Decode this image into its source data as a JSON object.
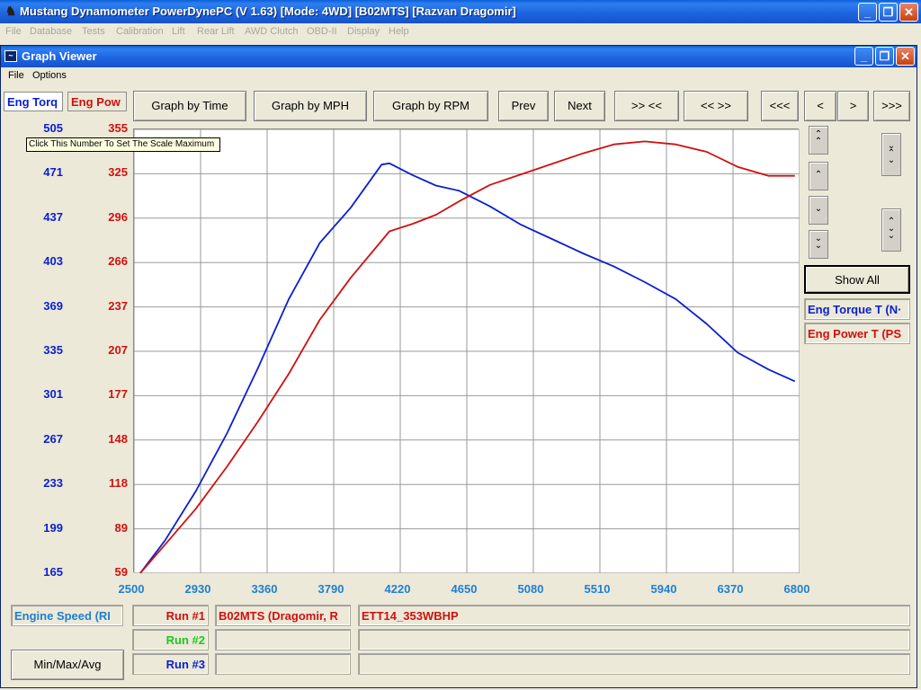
{
  "window": {
    "title": "Mustang Dynamometer PowerDynePC (V 1.63) [Mode: 4WD] [B02MTS] [Razvan Dragomir]",
    "minimize": "_",
    "restore": "❐",
    "close": "✕"
  },
  "menu": [
    "File",
    "Database",
    "Tests",
    "Calibration",
    "Lift",
    "Rear Lift",
    "AWD Clutch",
    "OBD-II",
    "Display",
    "Help"
  ],
  "graph_viewer": {
    "title": "Graph Viewer",
    "menu": [
      "File",
      "Options"
    ],
    "tabs": [
      "Eng Torq",
      "Eng Pow"
    ],
    "toolbar": {
      "graph_by_time": "Graph by Time",
      "graph_by_mph": "Graph by MPH",
      "graph_by_rpm": "Graph by RPM",
      "prev": "Prev",
      "next": "Next",
      "zoom_in": ">> <<",
      "zoom_out": "<< >>",
      "scroll_far_left": "<<<",
      "scroll_left": "<",
      "scroll_right": ">",
      "scroll_far_right": ">>>"
    },
    "tooltip": "Click This Number To Set The Scale Maximum",
    "show_all": "Show All",
    "legend": [
      {
        "label": "Eng Torque T (N·",
        "color": "#0a1fd0"
      },
      {
        "label": "Eng Power T (PS",
        "color": "#d01010"
      }
    ],
    "x_axis_name": "Engine Speed (RI",
    "min_max_avg": "Min/Max/Avg",
    "runs": [
      {
        "label": "Run #1",
        "color": "#d01010",
        "name": "B02MTS (Dragomir, R",
        "desc": "ETT14_353WBHP"
      },
      {
        "label": "Run #2",
        "color": "#1ec81e",
        "name": "",
        "desc": ""
      },
      {
        "label": "Run #3",
        "color": "#0a1fd0",
        "name": "",
        "desc": ""
      }
    ]
  },
  "chart_data": {
    "type": "line",
    "x_ticks": [
      2500,
      2930,
      3360,
      3790,
      4220,
      4650,
      5080,
      5510,
      5940,
      6370,
      6800
    ],
    "y_left_ticks": [
      505,
      471,
      437,
      403,
      369,
      335,
      301,
      267,
      233,
      199,
      165
    ],
    "y_right_ticks": [
      355,
      325,
      296,
      266,
      237,
      207,
      177,
      148,
      118,
      89,
      59
    ],
    "xlim": [
      2500,
      6800
    ],
    "y_left_lim": [
      165,
      505
    ],
    "y_right_lim": [
      59,
      355
    ],
    "colors": {
      "left": "#0a1fd0",
      "right": "#d01010",
      "x": "#1e7fd2"
    },
    "series": [
      {
        "axis": "left",
        "color": "#0a1fd0",
        "x": [
          2540,
          2700,
          2900,
          3100,
          3300,
          3500,
          3700,
          3900,
          4100,
          4150,
          4300,
          4450,
          4600,
          4800,
          5000,
          5200,
          5400,
          5600,
          5800,
          6000,
          6200,
          6400,
          6600,
          6770
        ],
        "y": [
          165,
          190,
          228,
          272,
          322,
          375,
          418,
          445,
          478,
          479,
          470,
          462,
          458,
          446,
          432,
          421,
          410,
          400,
          388,
          375,
          356,
          334,
          321,
          312
        ]
      },
      {
        "axis": "right",
        "color": "#d01010",
        "x": [
          2540,
          2700,
          2900,
          3100,
          3300,
          3500,
          3700,
          3900,
          4150,
          4300,
          4450,
          4600,
          4800,
          5000,
          5200,
          5400,
          5600,
          5800,
          6000,
          6200,
          6400,
          6600,
          6770
        ],
        "y": [
          59,
          78,
          102,
          130,
          160,
          192,
          228,
          256,
          287,
          292,
          298,
          307,
          318,
          325,
          332,
          339,
          345,
          347,
          345,
          340,
          330,
          324,
          324
        ]
      }
    ]
  }
}
